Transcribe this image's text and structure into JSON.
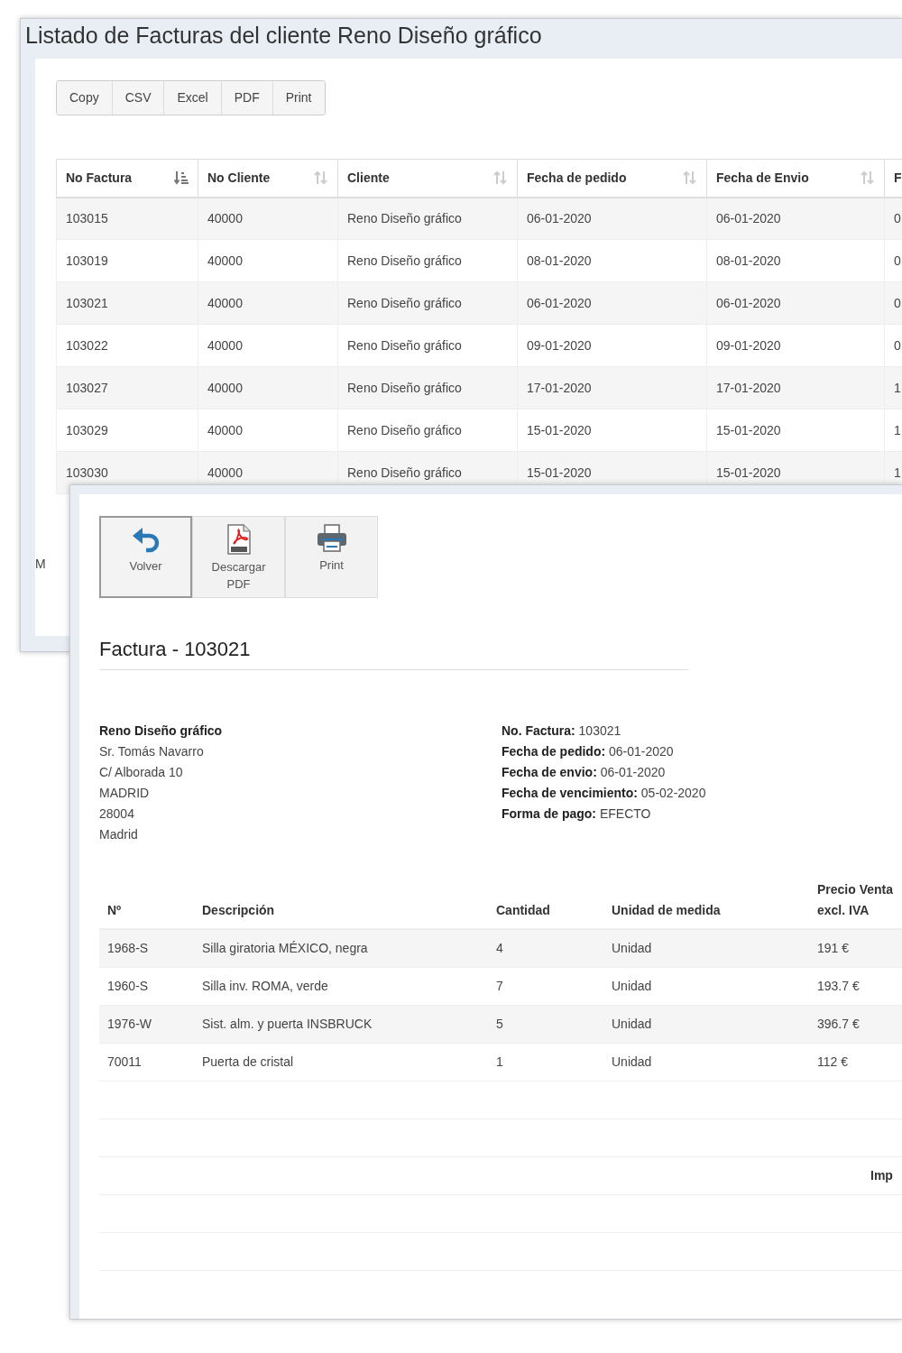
{
  "list_window": {
    "title": "Listado de Facturas del cliente Reno Diseño gráfico",
    "export_buttons": [
      "Copy",
      "CSV",
      "Excel",
      "PDF",
      "Print"
    ],
    "table": {
      "columns": [
        {
          "label": "No Factura",
          "sorted": true
        },
        {
          "label": "No Cliente",
          "sorted": false
        },
        {
          "label": "Cliente",
          "sorted": false
        },
        {
          "label": "Fecha de pedido",
          "sorted": false
        },
        {
          "label": "Fecha de Envio",
          "sorted": false
        },
        {
          "label": "F"
        }
      ],
      "rows": [
        [
          "103015",
          "40000",
          "Reno Diseño gráfico",
          "06-01-2020",
          "06-01-2020",
          "0"
        ],
        [
          "103019",
          "40000",
          "Reno Diseño gráfico",
          "08-01-2020",
          "08-01-2020",
          "0"
        ],
        [
          "103021",
          "40000",
          "Reno Diseño gráfico",
          "06-01-2020",
          "06-01-2020",
          "0"
        ],
        [
          "103022",
          "40000",
          "Reno Diseño gráfico",
          "09-01-2020",
          "09-01-2020",
          "0"
        ],
        [
          "103027",
          "40000",
          "Reno Diseño gráfico",
          "17-01-2020",
          "17-01-2020",
          "1"
        ],
        [
          "103029",
          "40000",
          "Reno Diseño gráfico",
          "15-01-2020",
          "15-01-2020",
          "1"
        ],
        [
          "103030",
          "40000",
          "Reno Diseño gráfico",
          "15-01-2020",
          "15-01-2020",
          "1"
        ]
      ]
    },
    "footer_text": "M"
  },
  "invoice_window": {
    "toolbar": [
      {
        "label": "Volver",
        "kind": "undo",
        "pressed": true
      },
      {
        "label": "Descargar PDF",
        "kind": "pdf",
        "pressed": false
      },
      {
        "label": "Print",
        "kind": "printer",
        "pressed": false
      }
    ],
    "title": "Factura - 103021",
    "customer": {
      "name": "Reno Diseño gráfico",
      "lines": [
        "Sr. Tomás Navarro",
        "C/ Alborada 10",
        "MADRID",
        "28004",
        "Madrid"
      ]
    },
    "details": [
      {
        "label": "No. Factura:",
        "value": "103021"
      },
      {
        "label": "Fecha de pedido:",
        "value": "06-01-2020"
      },
      {
        "label": "Fecha de envio:",
        "value": "06-01-2020"
      },
      {
        "label": "Fecha de vencimiento:",
        "value": "05-02-2020"
      },
      {
        "label": "Forma de pago:",
        "value": "EFECTO"
      }
    ],
    "items": {
      "columns": [
        "Nº",
        "Descripción",
        "Cantidad",
        "Unidad de medida",
        "Precio Venta excl. IVA"
      ],
      "rows": [
        [
          "1968-S",
          "Silla giratoria MÉXICO, negra",
          "4",
          "Unidad",
          "191 €"
        ],
        [
          "1960-S",
          "Silla inv. ROMA, verde",
          "7",
          "Unidad",
          "193.7 €"
        ],
        [
          "1976-W",
          "Sist. alm. y puerta INSBRUCK",
          "5",
          "Unidad",
          "396.7 €"
        ],
        [
          "70011",
          "Puerta de cristal",
          "1",
          "Unidad",
          "112 €"
        ]
      ]
    },
    "totals_label": "Imp"
  }
}
